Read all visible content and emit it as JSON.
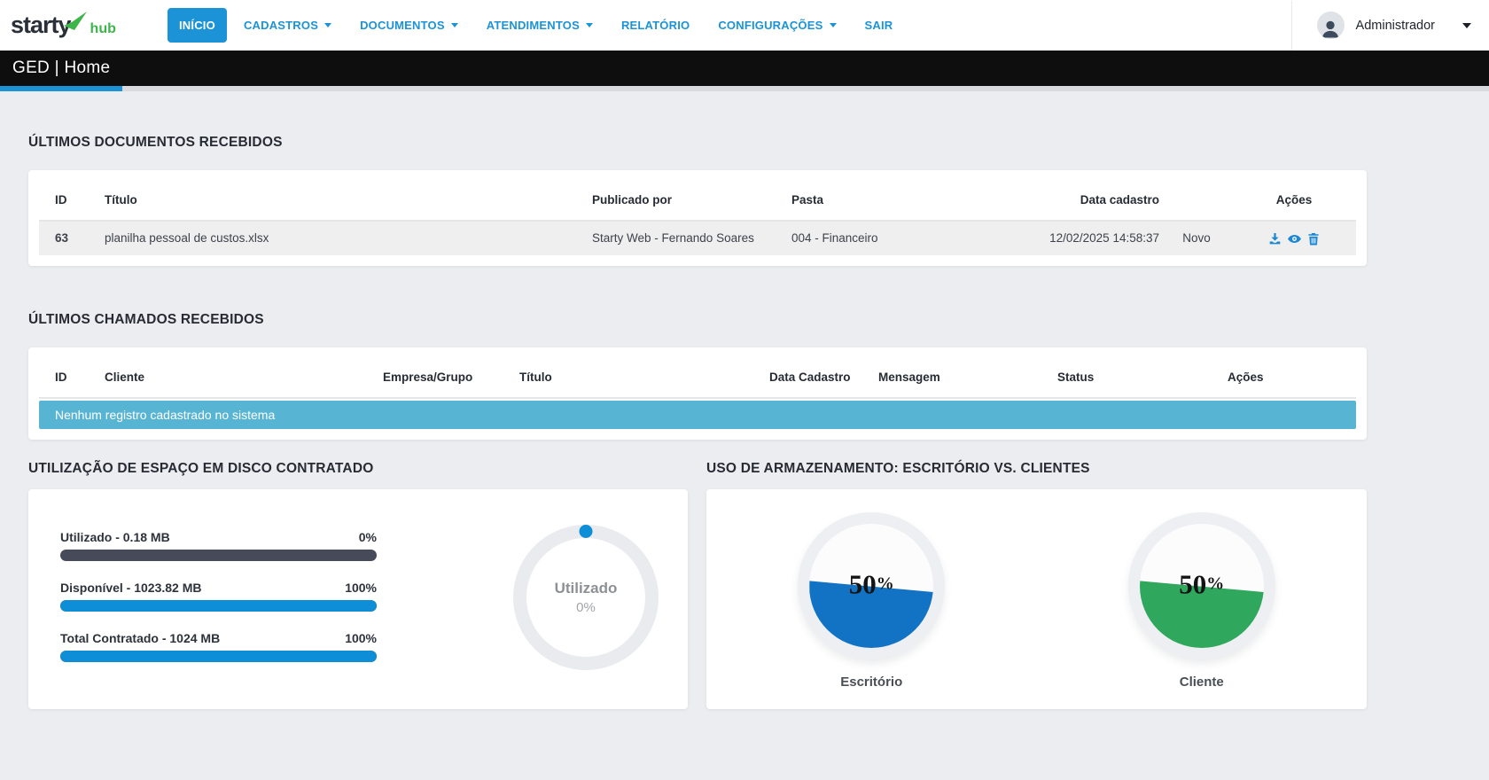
{
  "brand": {
    "primary": "starty",
    "secondary": "hub"
  },
  "navbar": {
    "items": [
      {
        "label": "INÍCIO",
        "active": true
      },
      {
        "label": "CADASTROS",
        "dropdown": true
      },
      {
        "label": "DOCUMENTOS",
        "dropdown": true
      },
      {
        "label": "ATENDIMENTOS",
        "dropdown": true
      },
      {
        "label": "RELATÓRIO"
      },
      {
        "label": "CONFIGURAÇÕES",
        "dropdown": true
      },
      {
        "label": "SAIR"
      }
    ],
    "user_name": "Administrador"
  },
  "page_header": {
    "title": "GED | Home"
  },
  "documents": {
    "section_title": "ÚLTIMOS DOCUMENTOS RECEBIDOS",
    "columns": {
      "id": "ID",
      "titulo": "Título",
      "publicado_por": "Publicado por",
      "pasta": "Pasta",
      "data_cadastro": "Data cadastro",
      "acoes": "Ações"
    },
    "row": {
      "id": "63",
      "titulo": "planilha pessoal de custos.xlsx",
      "publicado_por": "Starty Web - Fernando Soares",
      "pasta": "004 - Financeiro",
      "data_cadastro": "12/02/2025 14:58:37",
      "badge": "Novo"
    }
  },
  "chamados": {
    "section_title": "ÚLTIMOS CHAMADOS RECEBIDOS",
    "columns": {
      "id": "ID",
      "cliente": "Cliente",
      "empresa": "Empresa/Grupo",
      "titulo": "Título",
      "data_cadastro": "Data Cadastro",
      "mensagem": "Mensagem",
      "status": "Status",
      "acoes": "Ações"
    },
    "empty_message": "Nenhum registro cadastrado no sistema"
  },
  "disk": {
    "section_title": "UTILIZAÇÃO DE ESPAÇO EM DISCO CONTRATADO",
    "bars": [
      {
        "label": "Utilizado - 0.18 MB",
        "percent_label": "0%"
      },
      {
        "label": "Disponível - 1023.82 MB",
        "percent_label": "100%"
      },
      {
        "label": "Total Contratado - 1024 MB",
        "percent_label": "100%"
      }
    ],
    "donut": {
      "label": "Utilizado",
      "percent_label": "0%"
    }
  },
  "storage": {
    "section_title": "USO DE ARMAZENAMENTO: ESCRITÓRIO VS. CLIENTES",
    "gauges": [
      {
        "value": "50",
        "unit": "%",
        "label": "Escritório",
        "color": "#1273c4"
      },
      {
        "value": "50",
        "unit": "%",
        "label": "Cliente",
        "color": "#2fa85e"
      }
    ]
  },
  "colors": {
    "primary_blue": "#1b93d6",
    "bar_blue": "#0f8ed8",
    "bar_track_dark": "#474a58",
    "teal_info": "#58b4d3",
    "logo_green": "#3db54a"
  }
}
